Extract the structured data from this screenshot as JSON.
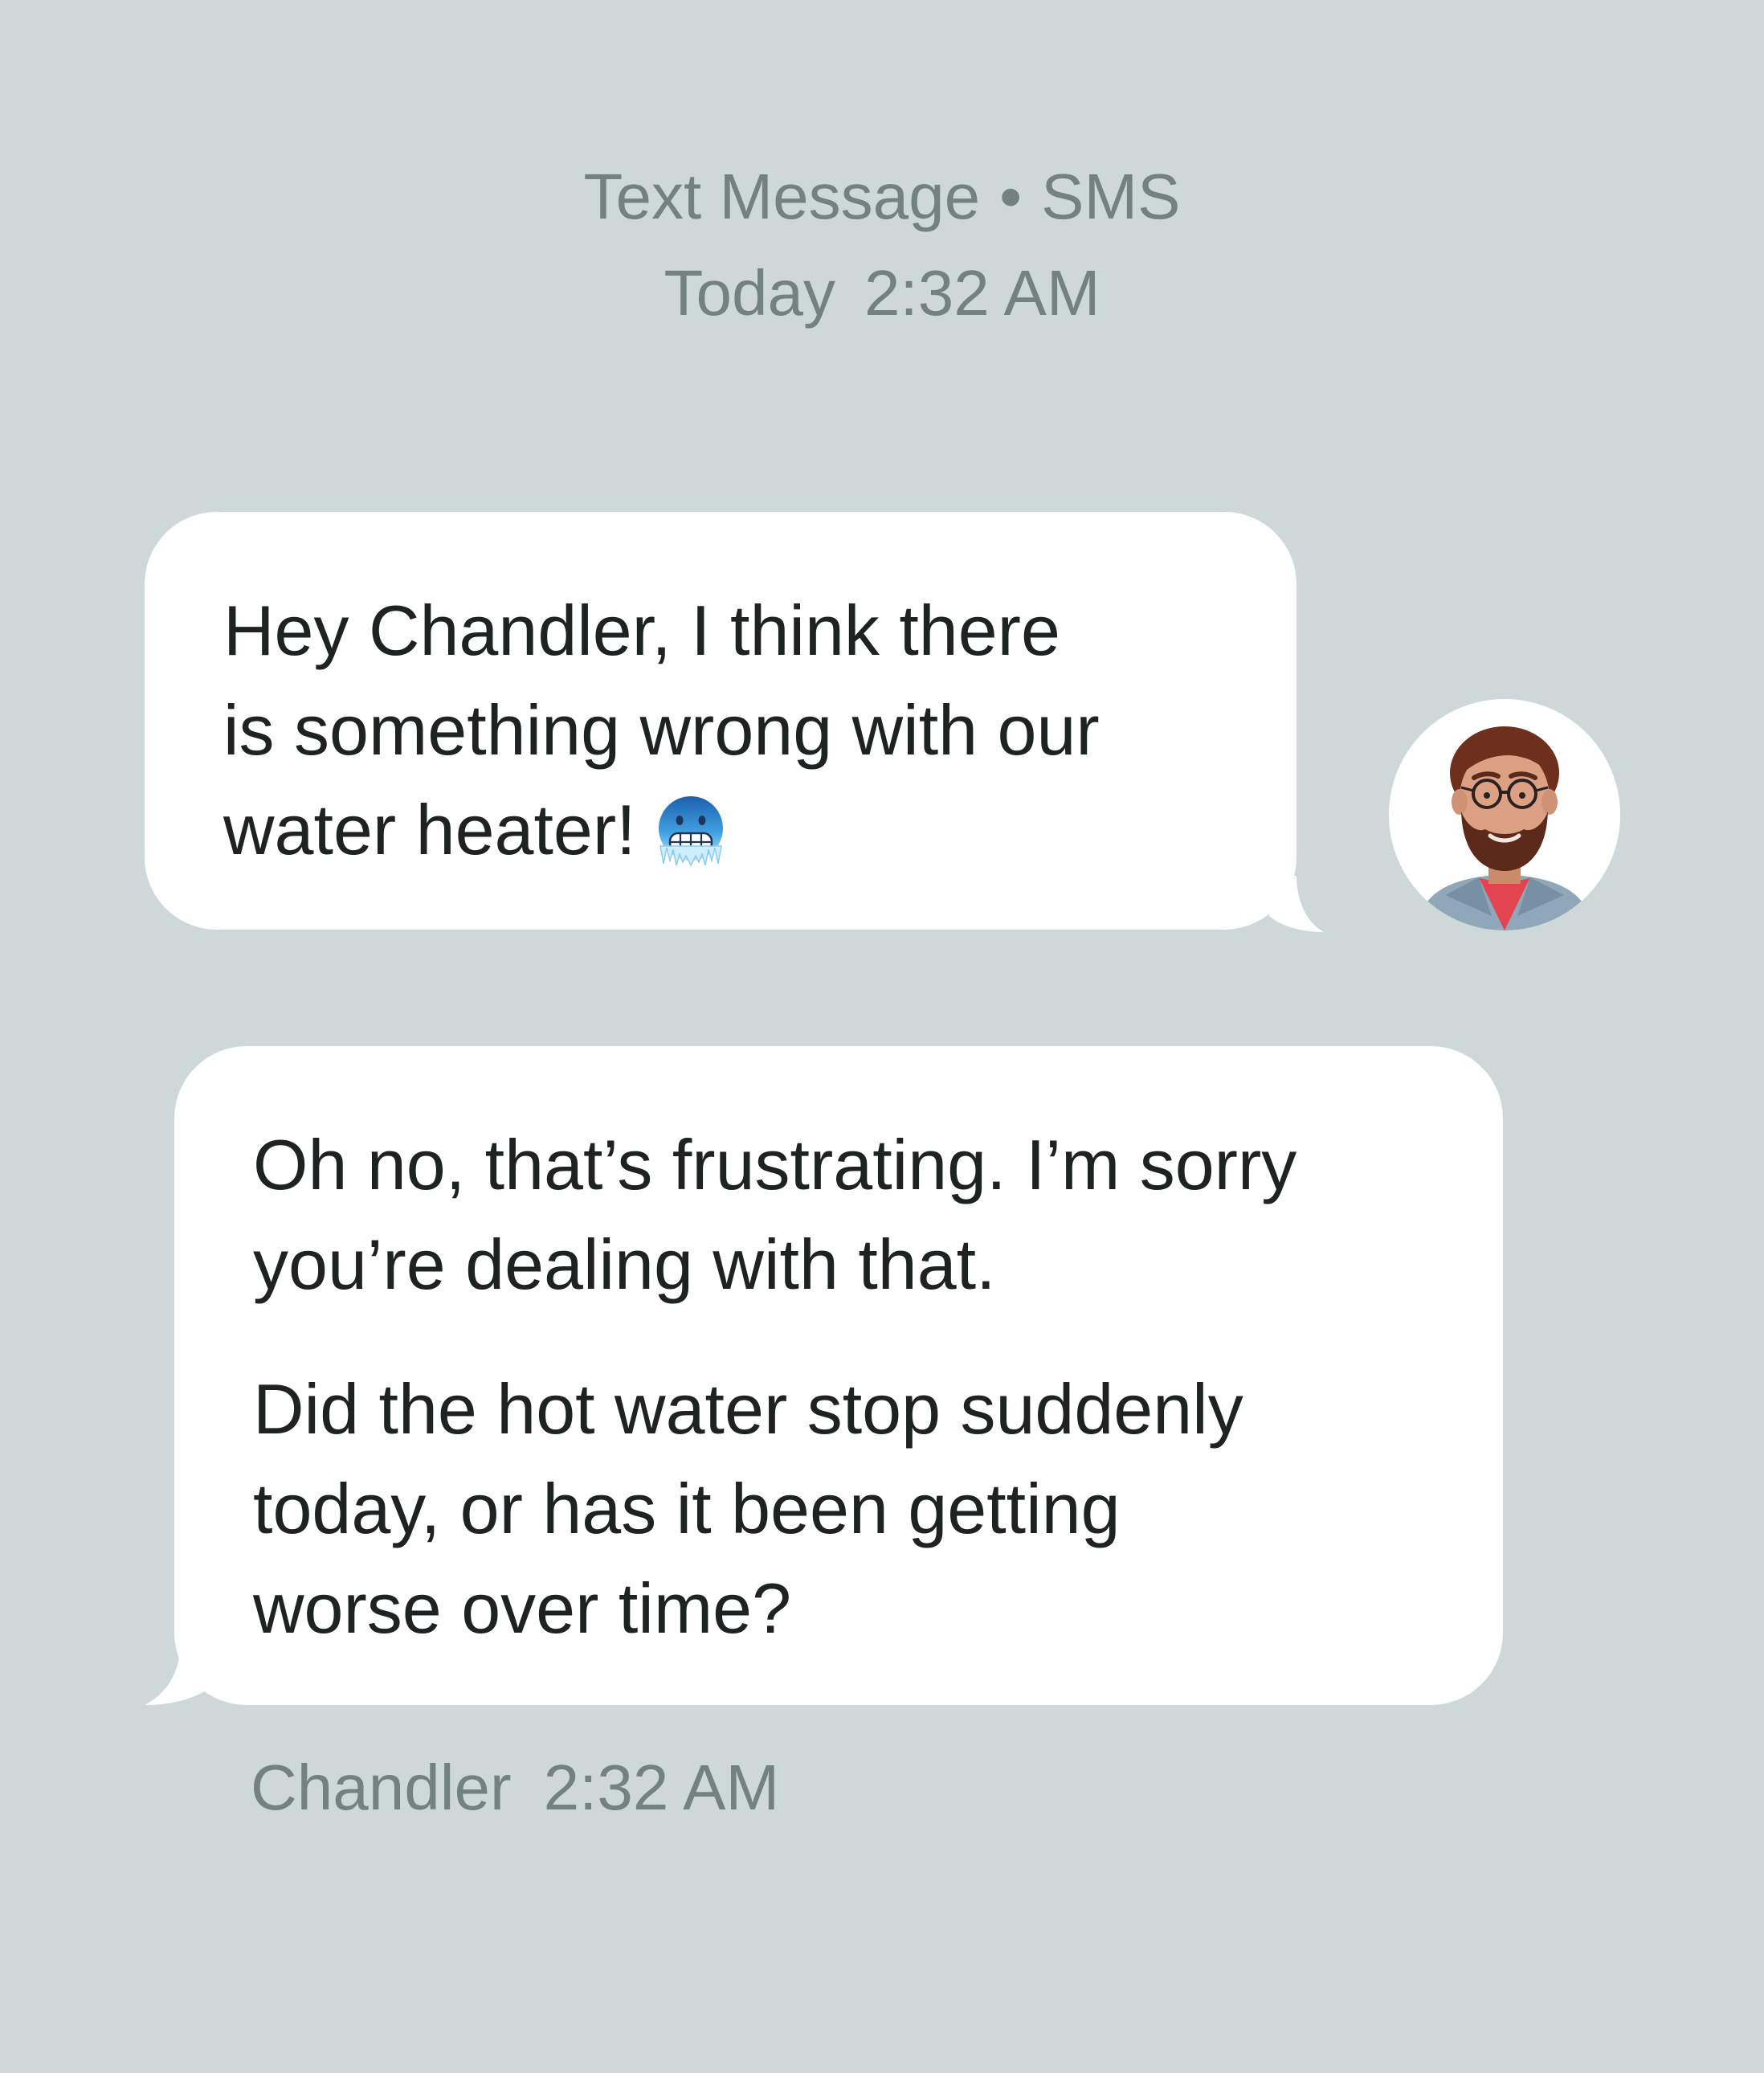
{
  "header": {
    "channel": "Text Message",
    "separator": "•",
    "type": "SMS",
    "day": "Today",
    "time": "2:32 AM"
  },
  "messages": [
    {
      "direction": "incoming",
      "lines": [
        "Hey Chandler, I think there",
        "is something wrong with our",
        "water heater!"
      ],
      "emoji": "cold-face-icon"
    },
    {
      "direction": "outgoing",
      "paragraphs": [
        [
          "Oh no, that’s frustrating. I’m sorry",
          "you’re dealing with that."
        ],
        [
          "Did the hot water stop suddenly",
          "today, or has it been getting",
          "worse over time?"
        ]
      ]
    }
  ],
  "footer": {
    "sender": "Chandler",
    "time": "2:32 AM"
  },
  "colors": {
    "background": "#cfd8d9",
    "bubble": "#ffffff",
    "meta_text": "#73817f",
    "message_text": "#1f2222"
  },
  "icons": {
    "avatar": "man-with-glasses-avatar",
    "emoji": "cold-face-icon"
  }
}
